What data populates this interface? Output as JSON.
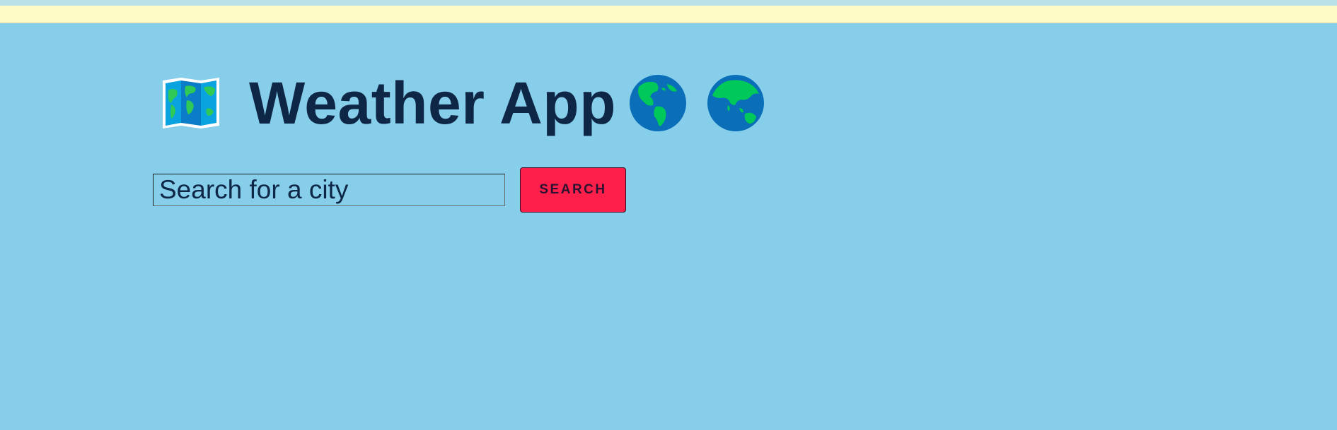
{
  "header": {
    "title": "Weather App",
    "leading_icon": "world-map-icon",
    "trailing_icons": [
      "globe-americas-icon",
      "globe-asia-australia-icon"
    ]
  },
  "search": {
    "placeholder": "Search for a city",
    "value": "",
    "button_label": "SEARCH"
  },
  "colors": {
    "background": "#87CEEB",
    "banner": "#FFFBC4",
    "title": "#0f2747",
    "button": "#FF1F4B",
    "globe_ocean": "#0A6FB8",
    "globe_land": "#00C85A"
  }
}
